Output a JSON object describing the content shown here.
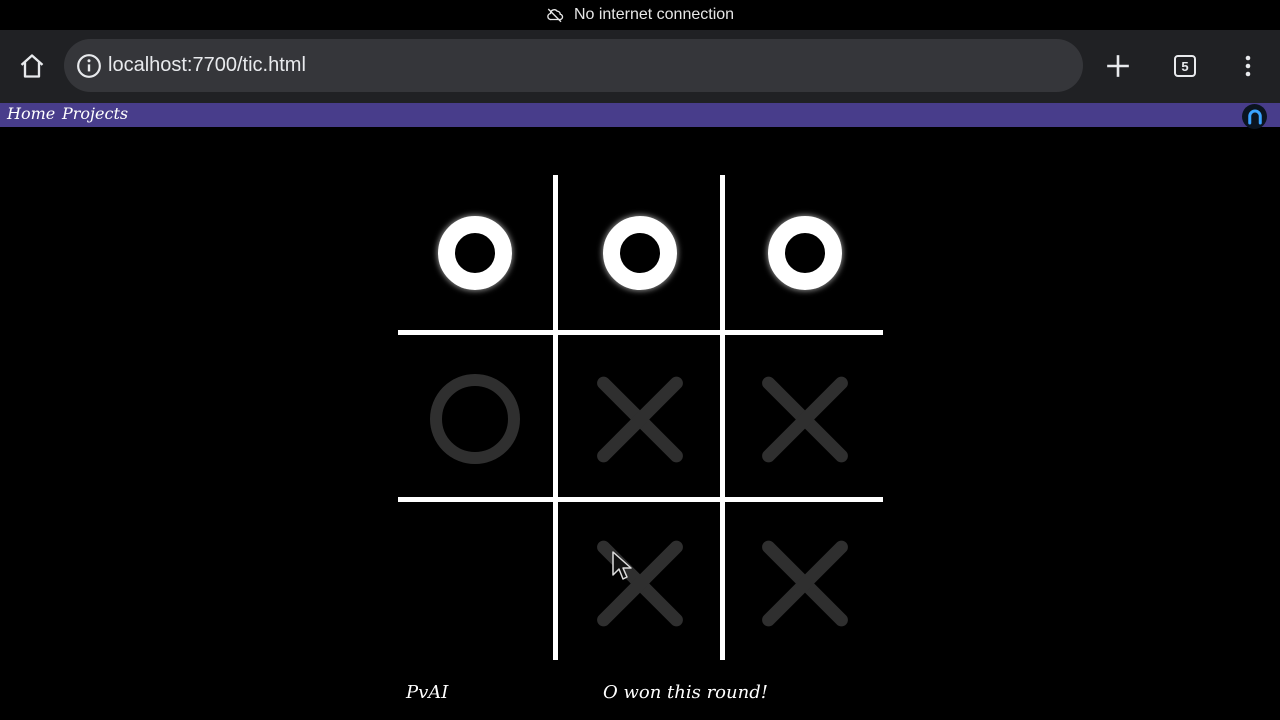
{
  "status": {
    "icon": "cloud-off-icon",
    "text": "No internet connection"
  },
  "browser": {
    "url": "localhost:7700/tic.html",
    "tab_count": "5",
    "icons": [
      "home-icon",
      "info-icon",
      "plus-icon",
      "tabs-icon",
      "more-vert-icon"
    ]
  },
  "nav": {
    "links": [
      {
        "label": "Home"
      },
      {
        "label": "Projects"
      }
    ],
    "bg_color": "#483d8b"
  },
  "board": {
    "cells": [
      {
        "mark": "O",
        "state": "winning"
      },
      {
        "mark": "O",
        "state": "winning"
      },
      {
        "mark": "O",
        "state": "winning"
      },
      {
        "mark": "O",
        "state": "dimmed"
      },
      {
        "mark": "X",
        "state": "dimmed"
      },
      {
        "mark": "X",
        "state": "dimmed"
      },
      {
        "mark": "",
        "state": "empty"
      },
      {
        "mark": "X",
        "state": "dimmed"
      },
      {
        "mark": "X",
        "state": "dimmed"
      }
    ]
  },
  "footer": {
    "mode": "PvAI",
    "result": "O won this round!"
  }
}
